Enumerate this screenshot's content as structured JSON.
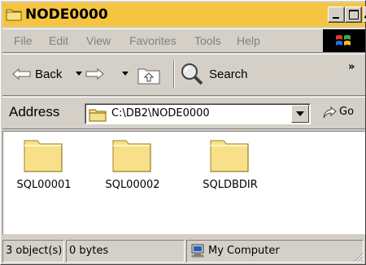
{
  "window": {
    "title": "NODE0000"
  },
  "menu": [
    "File",
    "Edit",
    "View",
    "Favorites",
    "Tools",
    "Help"
  ],
  "toolbar": {
    "back_label": "Back",
    "search_label": "Search",
    "more": "»"
  },
  "address": {
    "label": "Address",
    "value": "C:\\DB2\\NODE0000",
    "go_label": "Go"
  },
  "files": [
    {
      "name": "SQL00001",
      "icon": "folder-icon"
    },
    {
      "name": "SQL00002",
      "icon": "folder-icon"
    },
    {
      "name": "SQLDBDIR",
      "icon": "folder-icon"
    }
  ],
  "status": {
    "objects": "3 object(s)",
    "size": "0 bytes",
    "zone": "My Computer"
  },
  "colors": {
    "title_bar": "#f5c542",
    "chrome": "#d4d0c8",
    "folder": "#f8e08a"
  }
}
